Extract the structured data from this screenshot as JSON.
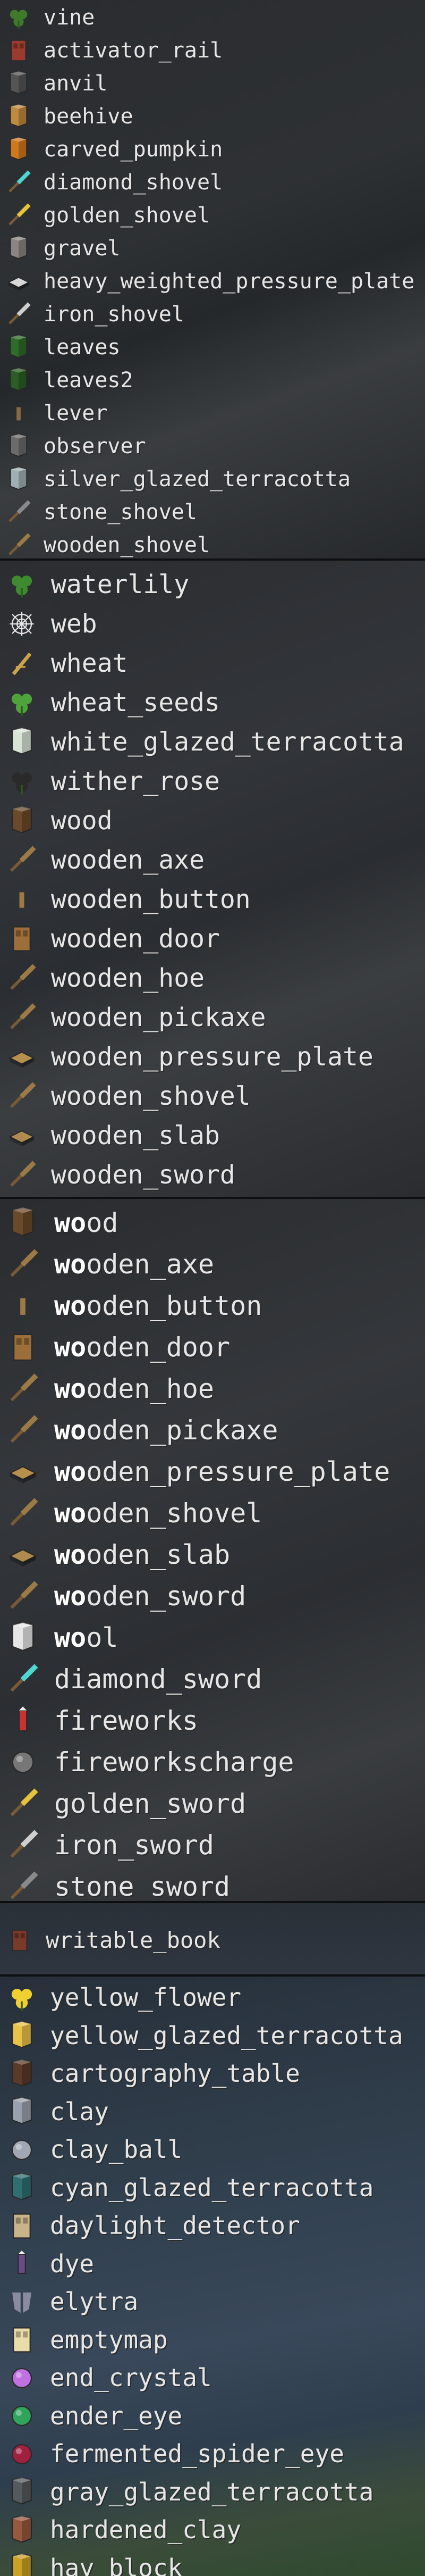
{
  "panels": [
    {
      "id": "panel-1",
      "items": [
        {
          "label": "vine",
          "icon": "vine-icon",
          "color": "#3f7a2a"
        },
        {
          "label": "activator_rail",
          "icon": "activator-rail-icon",
          "color": "#9b3b2f"
        },
        {
          "label": "anvil",
          "icon": "anvil-icon",
          "color": "#555555"
        },
        {
          "label": "beehive",
          "icon": "beehive-icon",
          "color": "#c08a3e"
        },
        {
          "label": "carved_pumpkin",
          "icon": "carved-pumpkin-icon",
          "color": "#d0781e"
        },
        {
          "label": "diamond_shovel",
          "icon": "diamond-shovel-icon",
          "color": "#4fd6d0"
        },
        {
          "label": "golden_shovel",
          "icon": "golden-shovel-icon",
          "color": "#e7c33a"
        },
        {
          "label": "gravel",
          "icon": "gravel-icon",
          "color": "#8a8582"
        },
        {
          "label": "heavy_weighted_pressure_plate",
          "icon": "heavy-weighted-pressure-plate-icon",
          "color": "#d8d8d8"
        },
        {
          "label": "iron_shovel",
          "icon": "iron-shovel-icon",
          "color": "#cfcfcf"
        },
        {
          "label": "leaves",
          "icon": "leaves-icon",
          "color": "#2f6b2a"
        },
        {
          "label": "leaves2",
          "icon": "leaves2-icon",
          "color": "#2a5e24"
        },
        {
          "label": "lever",
          "icon": "lever-icon",
          "color": "#8a6a45"
        },
        {
          "label": "observer",
          "icon": "observer-icon",
          "color": "#6b6b6b"
        },
        {
          "label": "silver_glazed_terracotta",
          "icon": "silver-glazed-terracotta-icon",
          "color": "#9fb0b5"
        },
        {
          "label": "stone_shovel",
          "icon": "stone-shovel-icon",
          "color": "#8a8a8a"
        },
        {
          "label": "wooden_shovel",
          "icon": "wooden-shovel-icon",
          "color": "#9c7a45"
        }
      ]
    },
    {
      "id": "panel-2",
      "items": [
        {
          "label": "waterlily",
          "icon": "waterlily-icon",
          "color": "#3e8a2e"
        },
        {
          "label": "web",
          "icon": "web-icon",
          "color": "#e8e8e8"
        },
        {
          "label": "wheat",
          "icon": "wheat-icon",
          "color": "#c9a44a"
        },
        {
          "label": "wheat_seeds",
          "icon": "wheat-seeds-icon",
          "color": "#4ea33a"
        },
        {
          "label": "white_glazed_terracotta",
          "icon": "white-glazed-terracotta-icon",
          "color": "#d9e4d6"
        },
        {
          "label": "wither_rose",
          "icon": "wither-rose-icon",
          "color": "#2a2a2a"
        },
        {
          "label": "wood",
          "icon": "wood-icon",
          "color": "#6b4a2a"
        },
        {
          "label": "wooden_axe",
          "icon": "wooden-axe-icon",
          "color": "#9c7a45"
        },
        {
          "label": "wooden_button",
          "icon": "wooden-button-icon",
          "color": "#9c7a45"
        },
        {
          "label": "wooden_door",
          "icon": "wooden-door-icon",
          "color": "#9c6e3a"
        },
        {
          "label": "wooden_hoe",
          "icon": "wooden-hoe-icon",
          "color": "#9c7a45"
        },
        {
          "label": "wooden_pickaxe",
          "icon": "wooden-pickaxe-icon",
          "color": "#9c7a45"
        },
        {
          "label": "wooden_pressure_plate",
          "icon": "wooden-pressure-plate-icon",
          "color": "#b8904e"
        },
        {
          "label": "wooden_shovel",
          "icon": "wooden-shovel-icon",
          "color": "#9c7a45"
        },
        {
          "label": "wooden_slab",
          "icon": "wooden-slab-icon",
          "color": "#b08a4e"
        },
        {
          "label": "wooden_sword",
          "icon": "wooden-sword-icon",
          "color": "#9c7a45"
        }
      ]
    },
    {
      "id": "panel-3",
      "highlight": "wo",
      "items": [
        {
          "label": "wood",
          "icon": "wood-icon",
          "color": "#6b4a2a"
        },
        {
          "label": "wooden_axe",
          "icon": "wooden-axe-icon",
          "color": "#9c7a45"
        },
        {
          "label": "wooden_button",
          "icon": "wooden-button-icon",
          "color": "#9c7a45"
        },
        {
          "label": "wooden_door",
          "icon": "wooden-door-icon",
          "color": "#9c6e3a"
        },
        {
          "label": "wooden_hoe",
          "icon": "wooden-hoe-icon",
          "color": "#9c7a45"
        },
        {
          "label": "wooden_pickaxe",
          "icon": "wooden-pickaxe-icon",
          "color": "#9c7a45"
        },
        {
          "label": "wooden_pressure_plate",
          "icon": "wooden-pressure-plate-icon",
          "color": "#b8904e"
        },
        {
          "label": "wooden_shovel",
          "icon": "wooden-shovel-icon",
          "color": "#9c7a45"
        },
        {
          "label": "wooden_slab",
          "icon": "wooden-slab-icon",
          "color": "#b08a4e"
        },
        {
          "label": "wooden_sword",
          "icon": "wooden-sword-icon",
          "color": "#9c7a45"
        },
        {
          "label": "wool",
          "icon": "wool-icon",
          "color": "#e6e6e6"
        },
        {
          "label": "diamond_sword",
          "icon": "diamond-sword-icon",
          "color": "#4fd6d0"
        },
        {
          "label": "fireworks",
          "icon": "fireworks-icon",
          "color": "#c83232"
        },
        {
          "label": "fireworkscharge",
          "icon": "fireworkscharge-icon",
          "color": "#777777"
        },
        {
          "label": "golden_sword",
          "icon": "golden-sword-icon",
          "color": "#e7c33a"
        },
        {
          "label": "iron_sword",
          "icon": "iron-sword-icon",
          "color": "#cfcfcf"
        },
        {
          "label": "stone_sword",
          "icon": "stone-sword-icon",
          "color": "#8a8a8a"
        }
      ]
    },
    {
      "id": "panel-4",
      "items": [
        {
          "label": "writable_book",
          "icon": "writable-book-icon",
          "color": "#7a3a2a"
        }
      ]
    },
    {
      "id": "panel-5",
      "items": [
        {
          "label": "yellow_flower",
          "icon": "yellow-flower-icon",
          "color": "#f0d030"
        },
        {
          "label": "yellow_glazed_terracotta",
          "icon": "yellow-glazed-terracotta-icon",
          "color": "#e9c24a"
        },
        {
          "label": "cartography_table",
          "icon": "cartography-table-icon",
          "color": "#5a3a28"
        },
        {
          "label": "clay",
          "icon": "clay-icon",
          "color": "#9aa1ae"
        },
        {
          "label": "clay_ball",
          "icon": "clay-ball-icon",
          "color": "#a2a8b3"
        },
        {
          "label": "cyan_glazed_terracotta",
          "icon": "cyan-glazed-terracotta-icon",
          "color": "#2f6f74"
        },
        {
          "label": "daylight_detector",
          "icon": "daylight-detector-icon",
          "color": "#c9b48a"
        },
        {
          "label": "dye",
          "icon": "dye-icon",
          "color": "#6a4a8a"
        },
        {
          "label": "elytra",
          "icon": "elytra-icon",
          "color": "#8a8aa0"
        },
        {
          "label": "emptymap",
          "icon": "emptymap-icon",
          "color": "#e8dca8"
        },
        {
          "label": "end_crystal",
          "icon": "end-crystal-icon",
          "color": "#c070e0"
        },
        {
          "label": "ender_eye",
          "icon": "ender-eye-icon",
          "color": "#2fa45a"
        },
        {
          "label": "fermented_spider_eye",
          "icon": "fermented-spider-eye-icon",
          "color": "#a02040"
        },
        {
          "label": "gray_glazed_terracotta",
          "icon": "gray-glazed-terracotta-icon",
          "color": "#555a5e"
        },
        {
          "label": "hardened_clay",
          "icon": "hardened-clay-icon",
          "color": "#96593e"
        },
        {
          "label": "hay_block",
          "icon": "hay-block-icon",
          "color": "#c9a226"
        }
      ]
    }
  ]
}
